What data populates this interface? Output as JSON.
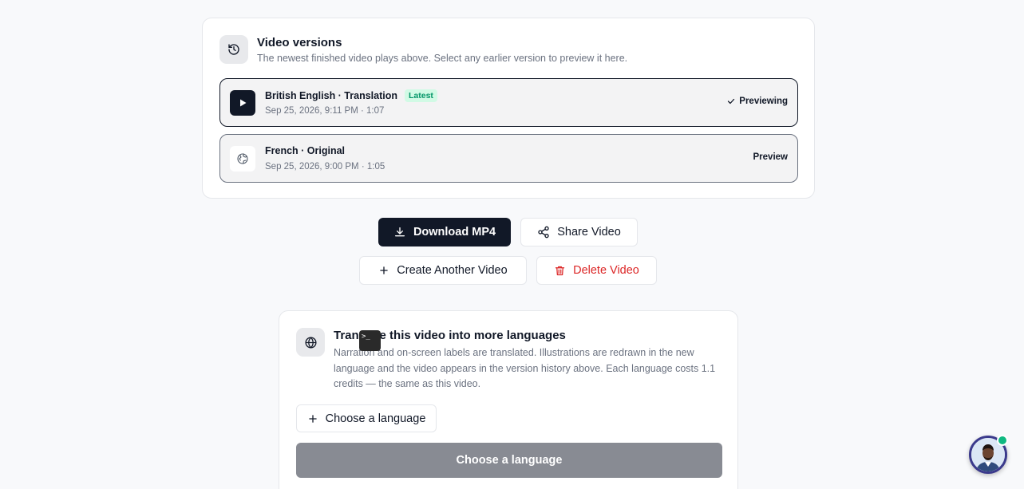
{
  "versions": {
    "title": "Video versions",
    "subtitle": "The newest finished video plays above. Select any earlier version to preview it here.",
    "items": [
      {
        "title": "British English · Translation",
        "badge": "Latest",
        "meta": "Sep 25, 2026, 9:11 PM · 1:07",
        "status": "Previewing",
        "icon": "play-icon"
      },
      {
        "title": "French · Original",
        "meta": "Sep 25, 2026, 9:00 PM · 1:05",
        "status": "Preview",
        "icon": "globe-icon"
      }
    ]
  },
  "actions": {
    "download_label": "Download MP4",
    "share_label": "Share Video",
    "create_label": "Create Another Video",
    "delete_label": "Delete Video"
  },
  "translate": {
    "title": "Translate this video into more languages",
    "description": "Narration and on-screen labels are translated. Illustrations are redrawn in the new language and the video appears in the version history above. Each language costs 1.1 credits — the same as this video.",
    "choose_label": "Choose a language",
    "submit_label": "Choose a language"
  },
  "terminal_chip": ">_",
  "colors": {
    "primary": "#111827",
    "danger": "#dc2626",
    "badge_green": "#059669",
    "disabled_button": "#888b93",
    "online": "#10b981"
  }
}
